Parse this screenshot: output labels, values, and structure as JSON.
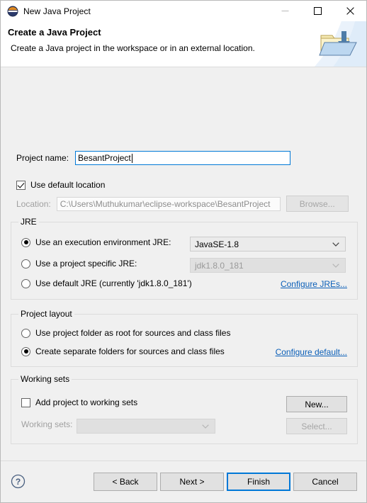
{
  "window": {
    "title": "New Java Project",
    "icon": "java-project-icon",
    "controls": {
      "minimize": "minimize-icon",
      "maximize": "maximize-icon",
      "close": "close-icon"
    }
  },
  "header": {
    "title": "Create a Java Project",
    "description": "Create a Java project in the workspace or in an external location.",
    "icon": "new-folder-icon"
  },
  "project_name": {
    "label": "Project name:",
    "value": "BesantProject",
    "placeholder": ""
  },
  "location": {
    "use_default_label": "Use default location",
    "use_default_checked": true,
    "label": "Location:",
    "value": "C:\\Users\\Muthukumar\\eclipse-workspace\\BesantProject",
    "browse_label": "Browse..."
  },
  "jre": {
    "group_title": "JRE",
    "options": [
      {
        "label": "Use an execution environment JRE:",
        "selected": true,
        "combo_value": "JavaSE-1.8",
        "combo_enabled": true
      },
      {
        "label": "Use a project specific JRE:",
        "selected": false,
        "combo_value": "jdk1.8.0_181",
        "combo_enabled": false
      },
      {
        "label": "Use default JRE (currently 'jdk1.8.0_181')",
        "selected": false
      }
    ],
    "configure_link": "Configure JREs..."
  },
  "project_layout": {
    "group_title": "Project layout",
    "options": [
      {
        "label": "Use project folder as root for sources and class files",
        "selected": false
      },
      {
        "label": "Create separate folders for sources and class files",
        "selected": true
      }
    ],
    "configure_link": "Configure default..."
  },
  "working_sets": {
    "group_title": "Working sets",
    "add_label": "Add project to working sets",
    "add_checked": false,
    "new_label": "New...",
    "list_label": "Working sets:",
    "list_value": "",
    "select_label": "Select..."
  },
  "footer": {
    "help_icon": "help-icon",
    "buttons": [
      {
        "label": "< Back",
        "enabled": true,
        "primary": false
      },
      {
        "label": "Next >",
        "enabled": true,
        "primary": false
      },
      {
        "label": "Finish",
        "enabled": true,
        "primary": true
      },
      {
        "label": "Cancel",
        "enabled": true,
        "primary": false
      }
    ]
  },
  "colors": {
    "accent": "#0078d7",
    "link": "#0b5fb8",
    "dialog_bg": "#f0f0f0",
    "header_bg": "#ffffff"
  }
}
